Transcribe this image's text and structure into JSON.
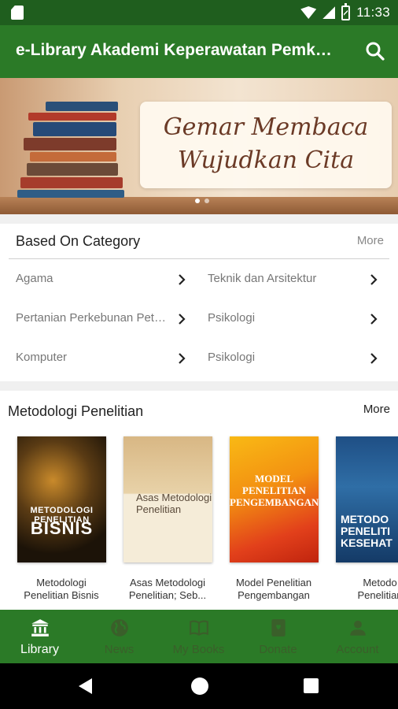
{
  "status_bar": {
    "time": "11:33"
  },
  "app_bar": {
    "title": "e-Library Akademi Keperawatan Pemkab Luwu"
  },
  "banner": {
    "line1": "Gemar Membaca",
    "line2": "Wujudkan Cita",
    "slide_count": 2,
    "active_slide": 1
  },
  "category_section": {
    "title": "Based On Category",
    "more": "More",
    "items": [
      {
        "label": "Agama"
      },
      {
        "label": "Teknik dan Arsitektur"
      },
      {
        "label": "Pertanian Perkebunan Peternakan"
      },
      {
        "label": "Psikologi"
      },
      {
        "label": "Komputer"
      },
      {
        "label": "Psikologi"
      }
    ]
  },
  "books_section": {
    "title": "Metodologi Penelitian",
    "more": "More",
    "books": [
      {
        "title_line1": "Metodologi",
        "title_line2": "Penelitian Bisnis",
        "cover_line1": "METODOLOGI PENELITIAN",
        "cover_line2": "BISNIS"
      },
      {
        "title_line1": "Asas Metodologi",
        "title_line2": "Penelitian; Seb...",
        "cover_line1": "Asas Metodologi Penelitian"
      },
      {
        "title_line1": "Model Penelitian",
        "title_line2": "Pengembangan",
        "cover_line1": "MODEL PENELITIAN PENGEMBANGAN"
      },
      {
        "title_line1": "Metodo",
        "title_line2": "Penelitian",
        "cover_line1": "METODO PENELITI KESEHAT"
      }
    ]
  },
  "bottom_nav": {
    "items": [
      {
        "label": "Library",
        "icon": "library-icon",
        "active": true
      },
      {
        "label": "News",
        "icon": "globe-icon",
        "active": false
      },
      {
        "label": "My Books",
        "icon": "book-open-icon",
        "active": false
      },
      {
        "label": "Donate",
        "icon": "donate-book-icon",
        "active": false
      },
      {
        "label": "Account",
        "icon": "person-icon",
        "active": false
      }
    ]
  },
  "colors": {
    "primary": "#2b7a27",
    "primary_dark": "#1f5e1e",
    "inactive_nav": "#3a5f2a"
  }
}
